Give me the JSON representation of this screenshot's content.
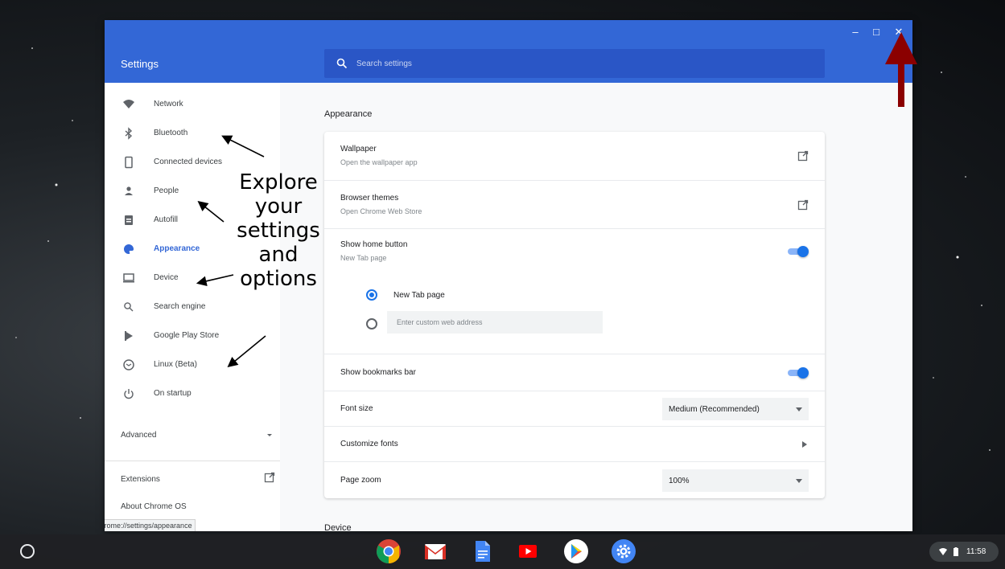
{
  "window": {
    "controls": {
      "minimize": "–",
      "maximize": "□",
      "close": "✕"
    }
  },
  "header": {
    "title": "Settings",
    "search_placeholder": "Search settings"
  },
  "sidebar": {
    "items": [
      {
        "label": "Network",
        "icon": "wifi-icon"
      },
      {
        "label": "Bluetooth",
        "icon": "bluetooth-icon"
      },
      {
        "label": "Connected devices",
        "icon": "phone-icon"
      },
      {
        "label": "People",
        "icon": "person-icon"
      },
      {
        "label": "Autofill",
        "icon": "clipboard-icon"
      },
      {
        "label": "Appearance",
        "icon": "palette-icon",
        "active": true
      },
      {
        "label": "Device",
        "icon": "laptop-icon"
      },
      {
        "label": "Search engine",
        "icon": "search-icon"
      },
      {
        "label": "Google Play Store",
        "icon": "play-store-icon"
      },
      {
        "label": "Linux (Beta)",
        "icon": "linux-icon"
      },
      {
        "label": "On startup",
        "icon": "power-icon"
      }
    ],
    "advanced": "Advanced",
    "extensions": "Extensions",
    "about": "About Chrome OS",
    "status_url": "chrome://settings/appearance"
  },
  "main": {
    "section_title": "Appearance",
    "wallpaper": {
      "title": "Wallpaper",
      "subtitle": "Open the wallpaper app"
    },
    "themes": {
      "title": "Browser themes",
      "subtitle": "Open Chrome Web Store"
    },
    "home_button": {
      "title": "Show home button",
      "subtitle": "New Tab page",
      "enabled": true
    },
    "home_options": {
      "new_tab": "New Tab page",
      "custom_placeholder": "Enter custom web address",
      "selected": "new_tab"
    },
    "bookmarks_bar": {
      "title": "Show bookmarks bar",
      "enabled": true
    },
    "font_size": {
      "title": "Font size",
      "value": "Medium (Recommended)"
    },
    "customize_fonts": {
      "title": "Customize fonts"
    },
    "page_zoom": {
      "title": "Page zoom",
      "value": "100%"
    },
    "next_section": "Device"
  },
  "annotation": {
    "lines": [
      "Explore",
      "your",
      "settings",
      "and",
      "options"
    ],
    "arrow_color": "#8b0000"
  },
  "shelf": {
    "apps": [
      "chrome-icon",
      "gmail-icon",
      "docs-icon",
      "youtube-icon",
      "play-store-icon",
      "settings-app-icon"
    ],
    "time": "11:58"
  },
  "colors": {
    "accent": "#3367d6",
    "toggle": "#1a73e8"
  }
}
